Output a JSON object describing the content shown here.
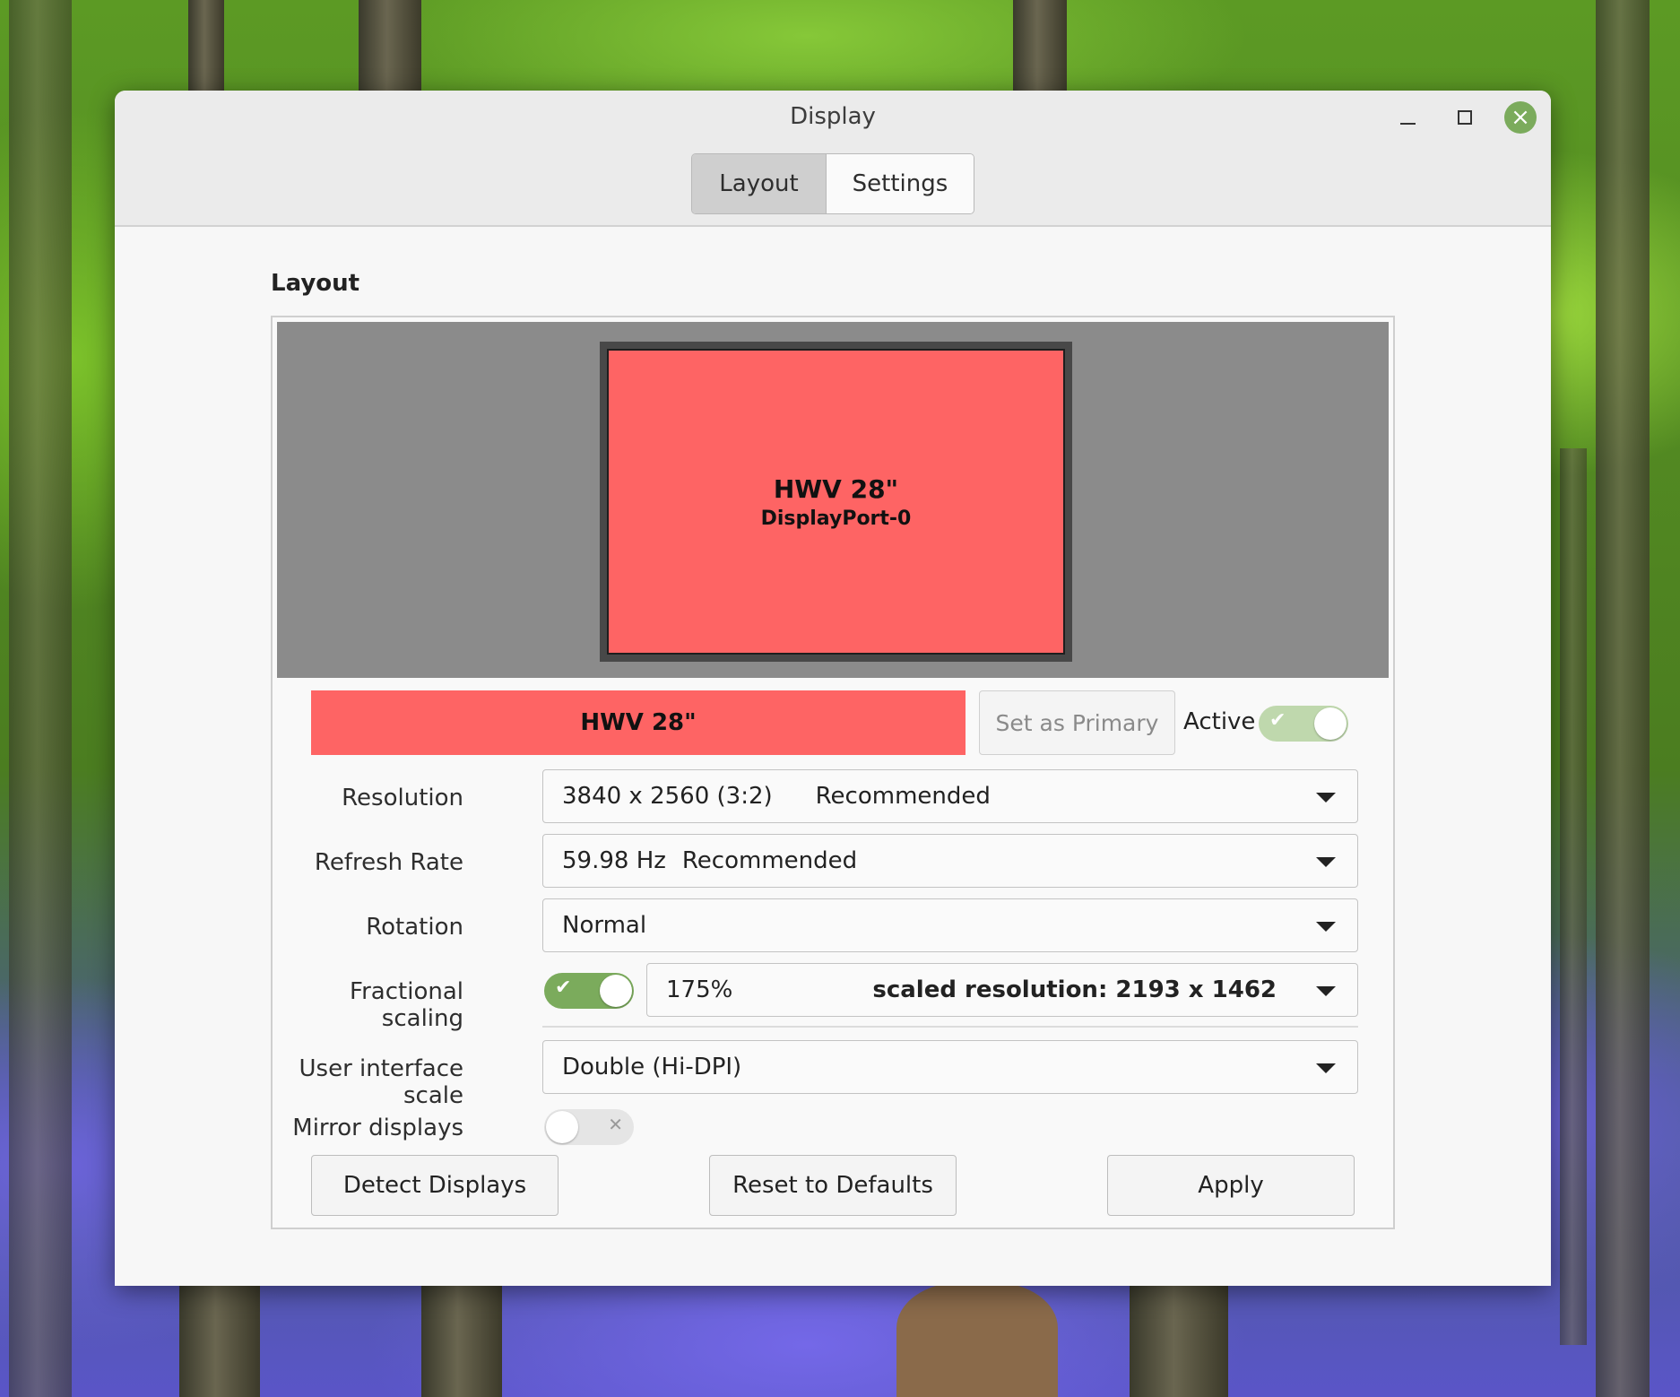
{
  "window": {
    "title": "Display",
    "close_icon": "close-icon",
    "minimize_icon": "minimize-icon",
    "maximize_icon": "maximize-icon",
    "accent_color": "#7bab5c"
  },
  "tabs": [
    {
      "label": "Layout",
      "active": true
    },
    {
      "label": "Settings",
      "active": false
    }
  ],
  "section_title": "Layout",
  "monitor": {
    "name": "HWV 28\"",
    "port": "DisplayPort-0",
    "color": "#fe6464"
  },
  "selected_monitor": {
    "name": "HWV 28\"",
    "set_primary_label": "Set as Primary",
    "active_label": "Active",
    "active_enabled": true
  },
  "settings": {
    "resolution": {
      "label": "Resolution",
      "value": "3840 x 2560 (3:2)",
      "note": "Recommended"
    },
    "refresh_rate": {
      "label": "Refresh Rate",
      "value": "59.98 Hz",
      "note": "Recommended"
    },
    "rotation": {
      "label": "Rotation",
      "value": "Normal"
    },
    "fractional_scaling": {
      "label": "Fractional scaling",
      "enabled": true,
      "value": "175%",
      "scaled_resolution": "scaled resolution: 2193 x 1462"
    },
    "ui_scale": {
      "label": "User interface scale",
      "value": "Double (Hi-DPI)"
    },
    "mirror": {
      "label": "Mirror displays",
      "enabled": false
    }
  },
  "buttons": {
    "detect": "Detect Displays",
    "reset": "Reset to Defaults",
    "apply": "Apply"
  }
}
